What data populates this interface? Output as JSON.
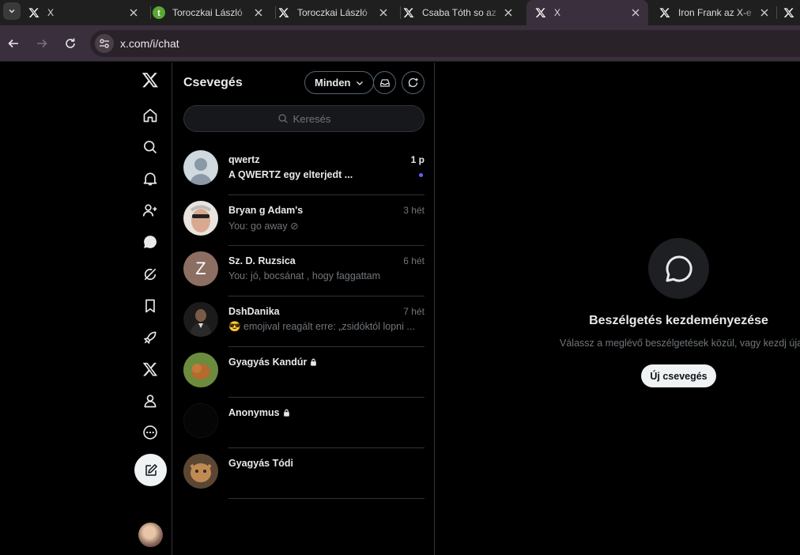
{
  "browser": {
    "tabs": [
      {
        "title": "X",
        "favicon": "x-logo"
      },
      {
        "title": "Toroczkai László",
        "favicon": "green-t"
      },
      {
        "title": "Toroczkai László",
        "favicon": "x-logo"
      },
      {
        "title": "Csaba Tóth so az",
        "favicon": "x-logo"
      },
      {
        "title": "X",
        "favicon": "x-logo",
        "active": true
      },
      {
        "title": "Iron Frank az X-e",
        "favicon": "x-logo"
      }
    ],
    "url": "x.com/i/chat"
  },
  "nav": {
    "items": [
      "x-logo",
      "home-icon",
      "search-icon",
      "notifications-icon",
      "follow-icon",
      "chat-icon",
      "grok-icon",
      "bookmarks-icon",
      "rocket-icon",
      "premium-x-icon",
      "profile-icon",
      "more-icon"
    ]
  },
  "chat_list": {
    "title": "Csevegés",
    "filter_label": "Minden",
    "search_placeholder": "Keresés",
    "conversations": [
      {
        "name": "qwertz",
        "time": "1 p",
        "preview": "A QWERTZ egy elterjedt ...",
        "unread": true
      },
      {
        "name": "Bryan g Adam's",
        "time": "3 hét",
        "preview": "You: go away ⊘"
      },
      {
        "name": "Sz. D. Ruzsica",
        "time": "6 hét",
        "preview": "You: jó, bocsánat , hogy  faggattam",
        "initial": "Z"
      },
      {
        "name": "DshDanika",
        "time": "7 hét",
        "preview": "😎 emojival reagált erre: „zsidóktól lopni ..."
      },
      {
        "name": "Gyagyás Kandúr",
        "time": "",
        "preview": "",
        "locked": true
      },
      {
        "name": "Anonymus",
        "time": "",
        "preview": "",
        "locked": true
      },
      {
        "name": "Gyagyás Tódi",
        "time": "",
        "preview": ""
      }
    ]
  },
  "empty_state": {
    "title": "Beszélgetés kezdeményezése",
    "subtitle": "Válassz a meglévő beszélgetések közül, vagy kezdj újat.",
    "button": "Új csevegés"
  },
  "colors": {
    "accent": "#7856ff",
    "background": "#000000",
    "border": "#2f3336",
    "muted": "#71767b"
  }
}
